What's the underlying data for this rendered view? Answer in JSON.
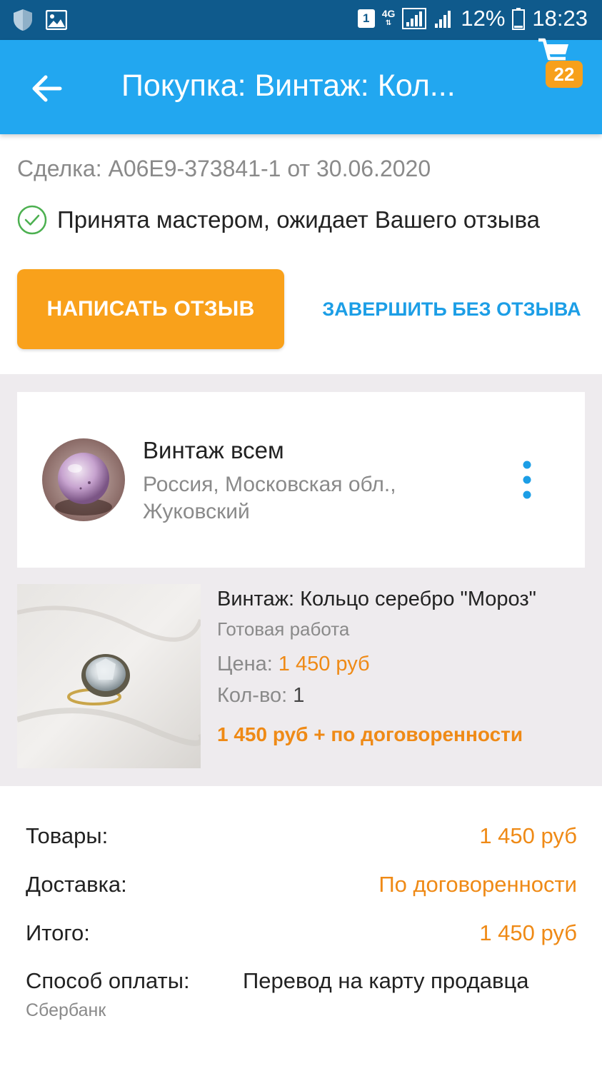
{
  "status_bar": {
    "sim": "1",
    "network": "4G",
    "battery": "12%",
    "time": "18:23"
  },
  "app_bar": {
    "title": "Покупка: Винтаж: Кол...",
    "cart_count": "22"
  },
  "deal": {
    "number_line": "Сделка: A06E9-373841-1 от 30.06.2020",
    "status_text": "Принята мастером, ожидает Вашего отзыва",
    "write_review_label": "НАПИСАТЬ ОТЗЫВ",
    "finish_without_review_label": "ЗАВЕРШИТЬ БЕЗ ОТЗЫВА"
  },
  "seller": {
    "name": "Винтаж всем",
    "location": "Россия, Московская обл., Жуковский"
  },
  "product": {
    "title": "Винтаж: Кольцо серебро \"Мороз\"",
    "type": "Готовая работа",
    "price_label": "Цена:",
    "price_value": "1 450 руб",
    "qty_label": "Кол-во:",
    "qty_value": "1",
    "total": "1 450 руб + по договоренности"
  },
  "summary": {
    "goods_label": "Товары:",
    "goods_value": "1 450 руб",
    "delivery_label": "Доставка:",
    "delivery_value": "По договоренности",
    "total_label": "Итого:",
    "total_value": "1 450 руб",
    "payment_label": "Способ оплаты:",
    "payment_value": "Перевод на карту продавца",
    "payment_sub": "Сбербанк"
  },
  "colors": {
    "status_bar": "#0f5a8c",
    "app_bar": "#22a7f0",
    "accent_orange": "#f9a11b",
    "link_blue": "#1c9ee6",
    "price_orange": "#ef8a16",
    "success_green": "#4cb050"
  }
}
